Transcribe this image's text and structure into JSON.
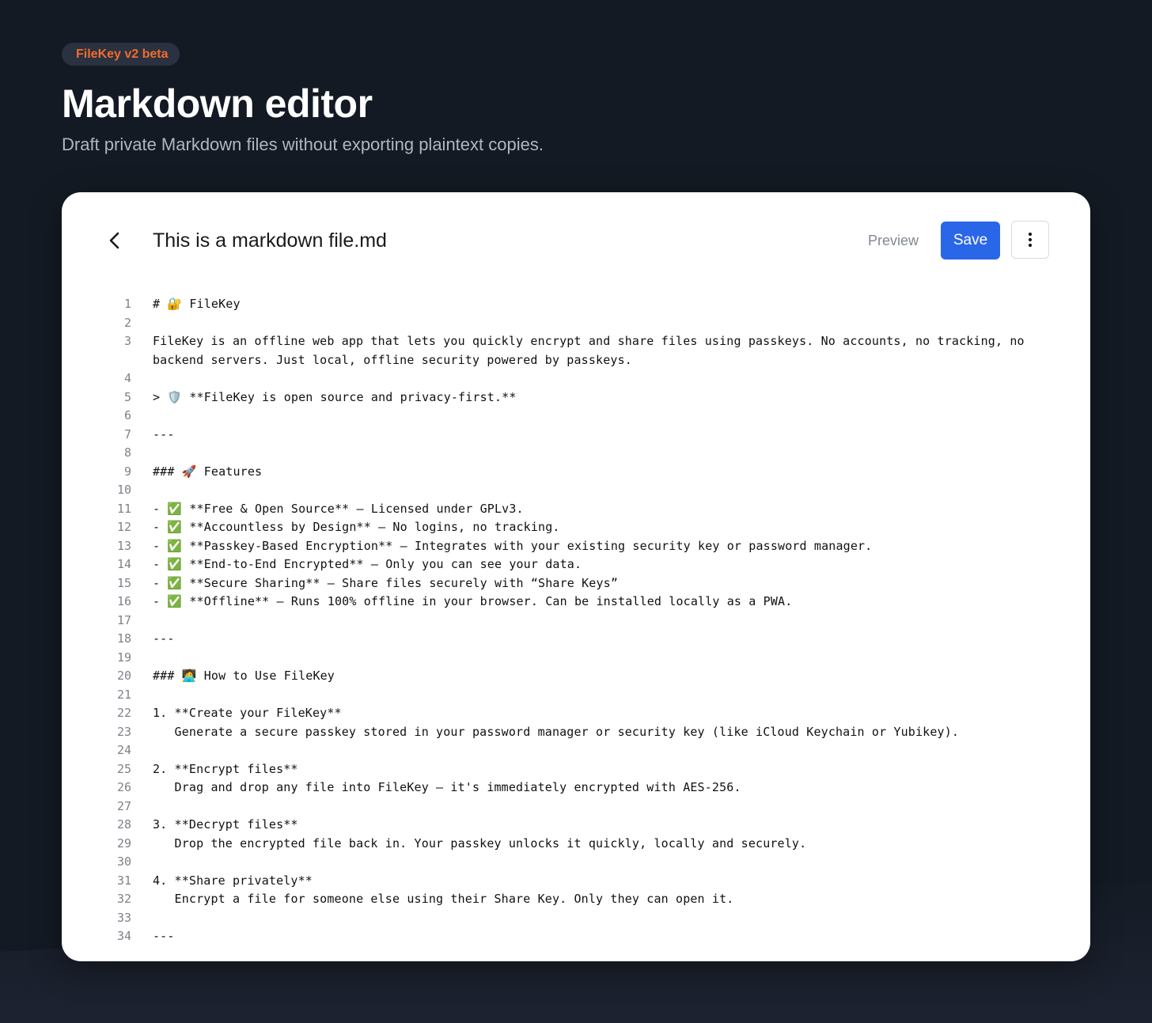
{
  "hero": {
    "badge": "FileKey v2 beta",
    "title": "Markdown editor",
    "subtitle": "Draft private Markdown files without exporting plaintext copies."
  },
  "toolbar": {
    "back_icon": "chevron-left-icon",
    "file_name": "This is a markdown file.md",
    "preview_label": "Preview",
    "save_label": "Save",
    "more_icon": "vertical-ellipsis-icon"
  },
  "colors": {
    "page_bg": "#141a23",
    "badge_text": "#f26b2a",
    "save_bg": "#2a66e8"
  },
  "editor": {
    "lines": [
      {
        "n": "1",
        "text": "# 🔐 FileKey"
      },
      {
        "n": "2",
        "text": ""
      },
      {
        "n": "3",
        "text": "FileKey is an offline web app that lets you quickly encrypt and share files using passkeys. No accounts, no tracking, no backend servers. Just local, offline security powered by passkeys."
      },
      {
        "n": "4",
        "text": ""
      },
      {
        "n": "5",
        "text": "> 🛡️ **FileKey is open source and privacy-first.**"
      },
      {
        "n": "6",
        "text": ""
      },
      {
        "n": "7",
        "text": "---"
      },
      {
        "n": "8",
        "text": ""
      },
      {
        "n": "9",
        "text": "### 🚀 Features"
      },
      {
        "n": "10",
        "text": ""
      },
      {
        "n": "11",
        "text": "- ✅ **Free & Open Source** – Licensed under GPLv3."
      },
      {
        "n": "12",
        "text": "- ✅ **Accountless by Design** – No logins, no tracking."
      },
      {
        "n": "13",
        "text": "- ✅ **Passkey-Based Encryption** – Integrates with your existing security key or password manager."
      },
      {
        "n": "14",
        "text": "- ✅ **End-to-End Encrypted** – Only you can see your data."
      },
      {
        "n": "15",
        "text": "- ✅ **Secure Sharing** – Share files securely with “Share Keys”"
      },
      {
        "n": "16",
        "text": "- ✅ **Offline** – Runs 100% offline in your browser. Can be installed locally as a PWA."
      },
      {
        "n": "17",
        "text": ""
      },
      {
        "n": "18",
        "text": "---"
      },
      {
        "n": "19",
        "text": ""
      },
      {
        "n": "20",
        "text": "### 🧑‍💻 How to Use FileKey"
      },
      {
        "n": "21",
        "text": ""
      },
      {
        "n": "22",
        "text": "1. **Create your FileKey**"
      },
      {
        "n": "23",
        "text": "   Generate a secure passkey stored in your password manager or security key (like iCloud Keychain or Yubikey)."
      },
      {
        "n": "24",
        "text": ""
      },
      {
        "n": "25",
        "text": "2. **Encrypt files**"
      },
      {
        "n": "26",
        "text": "   Drag and drop any file into FileKey – it's immediately encrypted with AES-256."
      },
      {
        "n": "27",
        "text": ""
      },
      {
        "n": "28",
        "text": "3. **Decrypt files**"
      },
      {
        "n": "29",
        "text": "   Drop the encrypted file back in. Your passkey unlocks it quickly, locally and securely."
      },
      {
        "n": "30",
        "text": ""
      },
      {
        "n": "31",
        "text": "4. **Share privately**"
      },
      {
        "n": "32",
        "text": "   Encrypt a file for someone else using their Share Key. Only they can open it."
      },
      {
        "n": "33",
        "text": ""
      },
      {
        "n": "34",
        "text": "---"
      }
    ]
  }
}
